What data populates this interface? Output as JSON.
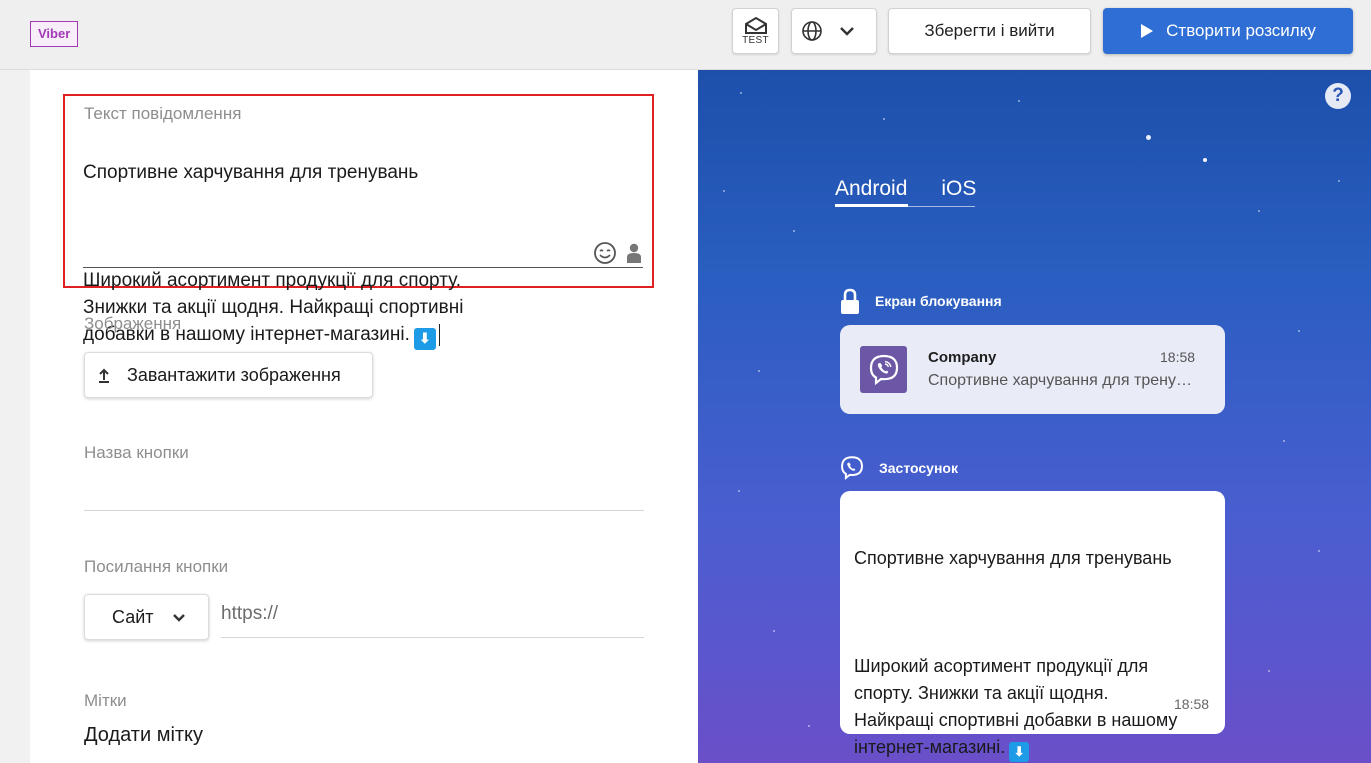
{
  "header": {
    "channel_badge": "Viber",
    "test_label": "TEST",
    "save_exit_label": "Зберегти і вийти",
    "create_label": "Створити розсилку"
  },
  "editor": {
    "message_label": "Текст повідомлення",
    "message_title": "Спортивне харчування для тренувань",
    "message_body": "Широкий асортимент продукції для спорту.\nЗнижки та акції щодня. Найкращі спортивні\nдобавки в нашому інтернет-магазині.",
    "message_emoji": "⬇",
    "image_label": "Зображення",
    "upload_label": "Завантажити зображення",
    "button_name_label": "Назва кнопки",
    "button_link_label": "Посилання кнопки",
    "link_type": "Сайт",
    "url_placeholder": "https://",
    "tags_label": "Мітки",
    "add_tag_label": "Додати мітку"
  },
  "preview": {
    "tabs": [
      "Android",
      "iOS"
    ],
    "active_tab": "Android",
    "lock_screen_title": "Екран блокування",
    "notification": {
      "sender": "Company",
      "time": "18:58",
      "text": "Спортивне харчування для тренувань"
    },
    "app_title": "Застосунок",
    "bubble": {
      "title": "Спортивне харчування для тренувань",
      "body": "Широкий асортимент продукції для\nспорту. Знижки та акції щодня.\nНайкращі спортивні добавки в нашому\nінтернет-магазині.",
      "emoji": "⬇",
      "time": "18:58"
    }
  },
  "colors": {
    "accent": "#2f6fd5",
    "viber_purple": "#6b57a6",
    "highlight_border": "#e02020"
  }
}
